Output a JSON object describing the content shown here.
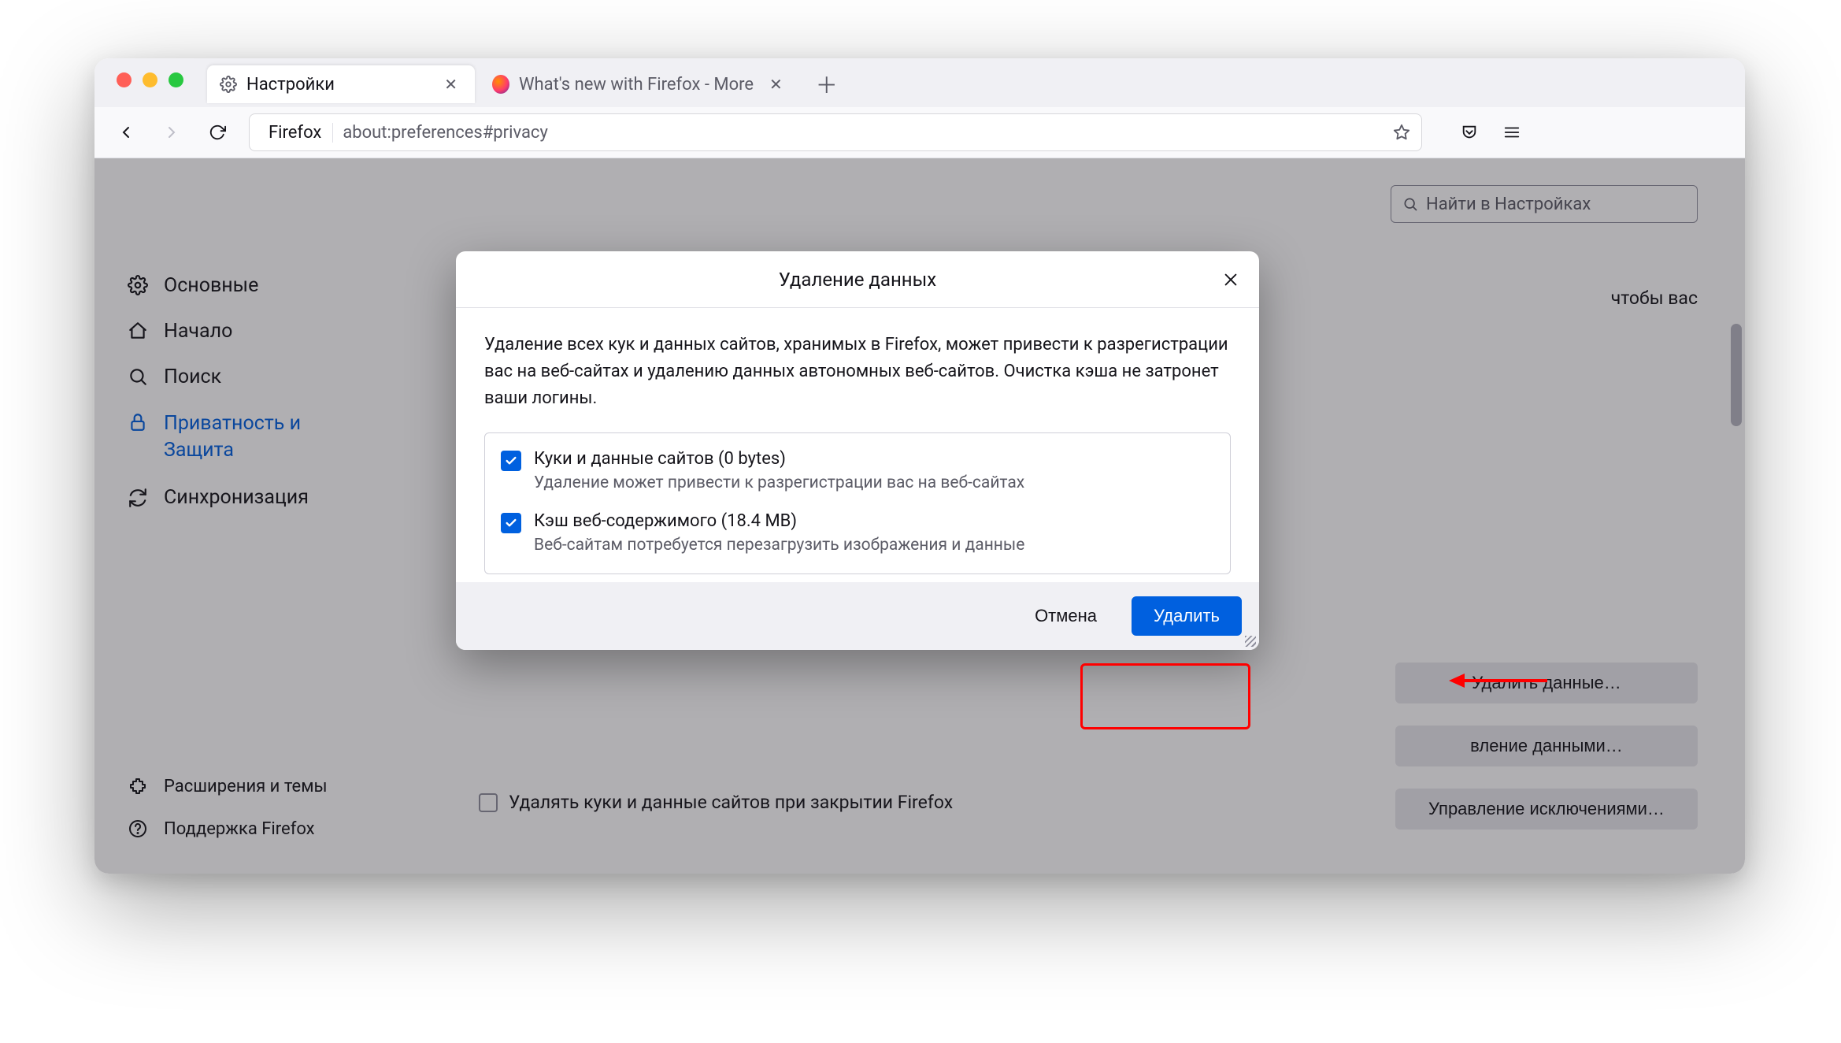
{
  "titlebar": {
    "tabs": [
      {
        "label": "Настройки",
        "active": true
      },
      {
        "label": "What's new with Firefox - More priva",
        "active": false
      }
    ]
  },
  "navbar": {
    "brand": "Firefox",
    "url": "about:preferences#privacy"
  },
  "search": {
    "placeholder": "Найти в Настройках"
  },
  "sidebar": {
    "items": [
      {
        "label": "Основные",
        "icon": "gear-icon"
      },
      {
        "label": "Начало",
        "icon": "home-icon"
      },
      {
        "label": "Поиск",
        "icon": "search-icon"
      },
      {
        "label1": "Приватность и",
        "label2": "Защита",
        "icon": "lock-icon",
        "active": true
      },
      {
        "label": "Синхронизация",
        "icon": "sync-icon"
      }
    ],
    "bottom": [
      {
        "label": "Расширения и темы",
        "icon": "puzzle-icon"
      },
      {
        "label": "Поддержка Firefox",
        "icon": "help-icon"
      }
    ]
  },
  "background": {
    "snippet": "чтобы вас",
    "buttons": {
      "clear_data": "Удалить данные…",
      "manage_data": "вление данными…",
      "exceptions": "Управление исключениями…"
    },
    "checkbox_label": "Удалять куки и данные сайтов при закрытии Firefox"
  },
  "modal": {
    "title": "Удаление данных",
    "description": "Удаление всех кук и данных сайтов, хранимых в Firefox, может привести к разрегистрации вас на веб-сайтах и удалению данных автономных веб-сайтов. Очистка кэша не затронет ваши логины.",
    "option1": {
      "title": "Куки и данные сайтов (0 bytes)",
      "sub": "Удаление может привести к разрегистрации вас на веб-сайтах"
    },
    "option2": {
      "title": "Кэш веб-содержимого (18.4 MB)",
      "sub": "Веб-сайтам потребуется перезагрузить изображения и данные"
    },
    "cancel": "Отмена",
    "confirm": "Удалить"
  }
}
